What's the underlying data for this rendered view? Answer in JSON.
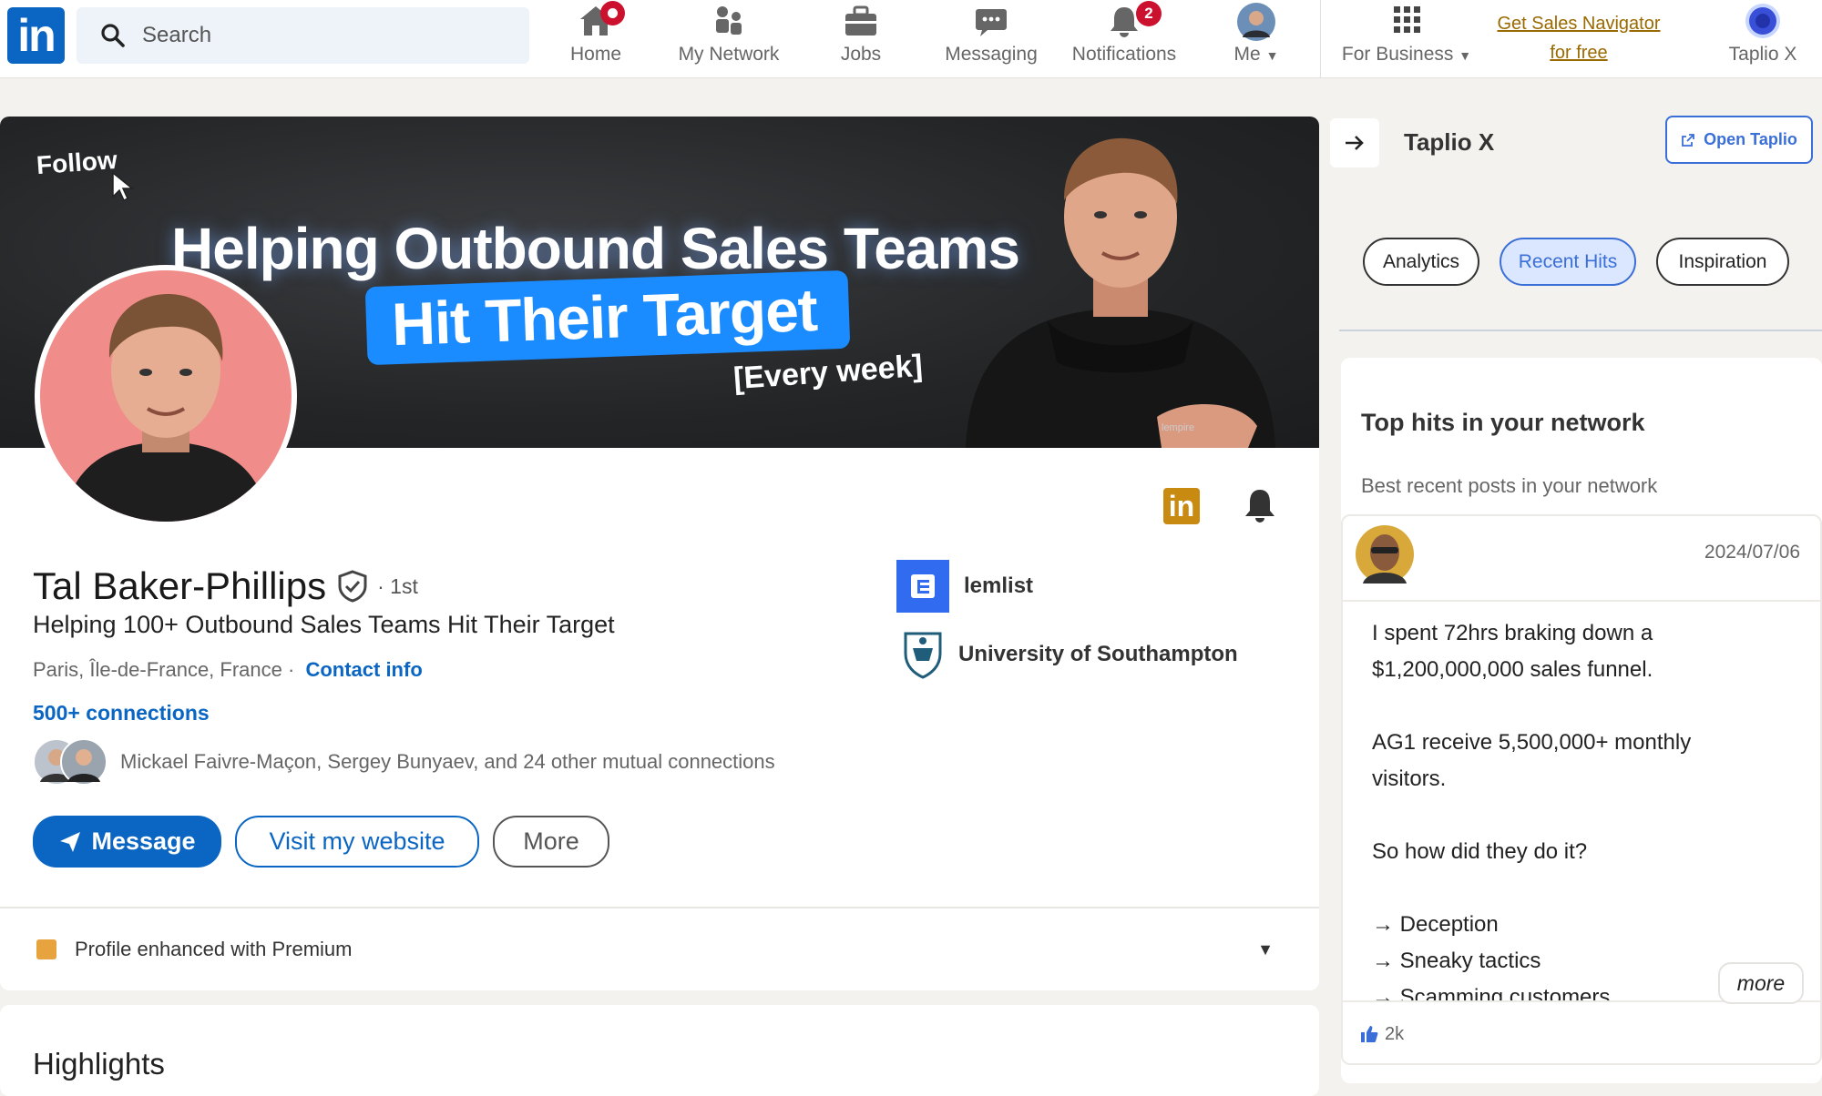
{
  "nav": {
    "search_placeholder": "Search",
    "items": [
      {
        "label": "Home",
        "icon": "home-icon"
      },
      {
        "label": "My Network",
        "icon": "network-icon"
      },
      {
        "label": "Jobs",
        "icon": "briefcase-icon"
      },
      {
        "label": "Messaging",
        "icon": "messaging-icon"
      },
      {
        "label": "Notifications",
        "icon": "bell-icon",
        "badge": "2"
      },
      {
        "label": "Me",
        "icon": "avatar"
      }
    ],
    "for_business": "For Business",
    "sales_nav_line1": "Get Sales Navigator",
    "sales_nav_line2": "for free",
    "taplio_label": "Taplio X"
  },
  "banner": {
    "follow": "Follow",
    "headline_1": "Helping Outbound Sales Teams",
    "headline_2": "Hit Their Target",
    "headline_3": "[Every week]",
    "shirt_logo": "lempire"
  },
  "profile": {
    "name": "Tal Baker-Phillips",
    "degree": "· 1st",
    "headline": "Helping 100+ Outbound Sales Teams Hit Their Target",
    "location": "Paris, Île-de-France, France ·",
    "contact_info": "Contact info",
    "connections": "500+ connections",
    "mutual": "Mickael Faivre-Maçon, Sergey Bunyaev, and 24 other mutual connections",
    "company": "lemlist",
    "school": "University of Southampton",
    "buttons": {
      "message": "Message",
      "website": "Visit my website",
      "more": "More"
    },
    "premium": "Profile enhanced with Premium",
    "highlights": "Highlights"
  },
  "taplio": {
    "title": "Taplio X",
    "open_button": "Open Taplio",
    "tabs": [
      {
        "label": "Analytics",
        "active": false
      },
      {
        "label": "Recent Hits",
        "active": true
      },
      {
        "label": "Inspiration",
        "active": false
      }
    ],
    "section_title": "Top hits in your network",
    "section_subtitle": "Best recent posts in your network",
    "post": {
      "date": "2024/07/06",
      "lines": [
        "I spent 72hrs braking down a",
        "$1,200,000,000 sales funnel.",
        "",
        "AG1 receive 5,500,000+ monthly",
        "visitors.",
        "",
        "So how did they do it?",
        "",
        "→ Deception",
        "→ Sneaky tactics",
        "→ Scamming customers"
      ],
      "more_label": "more",
      "likes": "2k"
    }
  },
  "colors": {
    "linkedin_blue": "#0a66c2",
    "notification_red": "#cb112d",
    "sales_nav_gold": "#9a6a00",
    "taplio_blue": "#3a6fd8"
  }
}
